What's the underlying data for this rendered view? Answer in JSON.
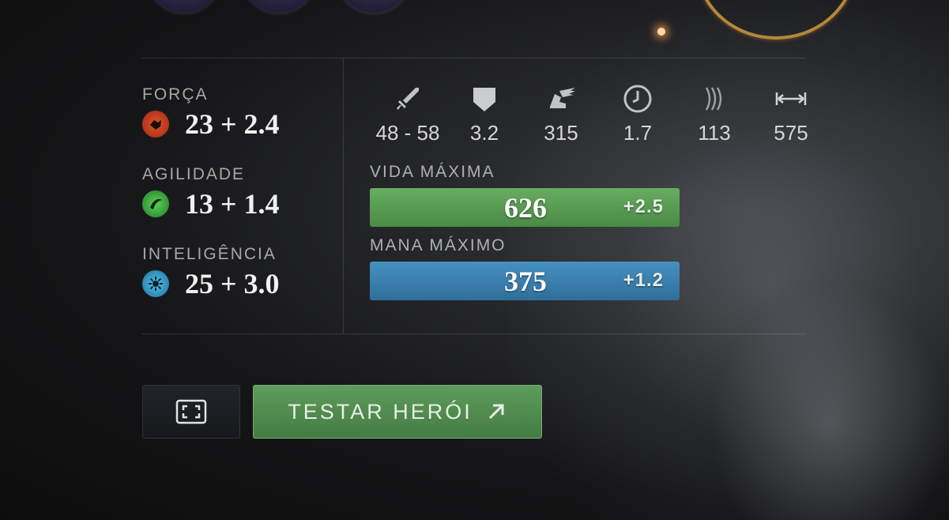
{
  "attributes": [
    {
      "label": "FORÇA",
      "value": "23 + 2.4",
      "icon": "strength-icon",
      "color": "#c23a1f"
    },
    {
      "label": "AGILIDADE",
      "value": "13 + 1.4",
      "icon": "agility-icon",
      "color": "#2fa13a"
    },
    {
      "label": "INTELIGÊNCIA",
      "value": "25 + 3.0",
      "icon": "intelligence-icon",
      "color": "#2a9fc9"
    }
  ],
  "stats": [
    {
      "icon": "sword-icon",
      "value": "48 - 58"
    },
    {
      "icon": "shield-icon",
      "value": "3.2"
    },
    {
      "icon": "winged-boot-icon",
      "value": "315"
    },
    {
      "icon": "clock-icon",
      "value": "1.7"
    },
    {
      "icon": "sound-waves-icon",
      "value": "113"
    },
    {
      "icon": "range-arrow-icon",
      "value": "575"
    }
  ],
  "health": {
    "label": "VIDA MÁXIMA",
    "value": "626",
    "regen": "+2.5",
    "color": "#5a9a55"
  },
  "mana": {
    "label": "MANA MÁXIMO",
    "value": "375",
    "regen": "+1.2",
    "color": "#3a82b0"
  },
  "buttons": {
    "expand_icon": "expand-icon",
    "demo_label": "TESTAR HERÓI",
    "demo_icon": "arrow-up-right-icon"
  }
}
